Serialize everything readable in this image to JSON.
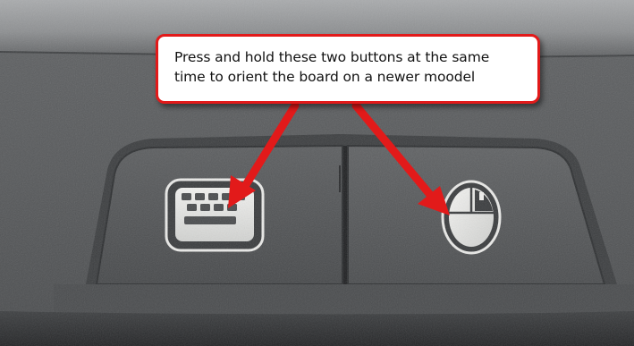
{
  "callout": {
    "line1": "Press and hold these two buttons at the same",
    "line2": "time to orient the board on a newer moodel"
  },
  "colors": {
    "arrow": "#e21a1a",
    "callout_border": "#e21a1a",
    "callout_fill": "#ffffff",
    "plastic_body": "#57595b",
    "keyboard_button": "#4f5153",
    "mouse_button": "#535557"
  },
  "icons": {
    "left_button": "keyboard-icon",
    "right_button": "mouse-icon"
  }
}
